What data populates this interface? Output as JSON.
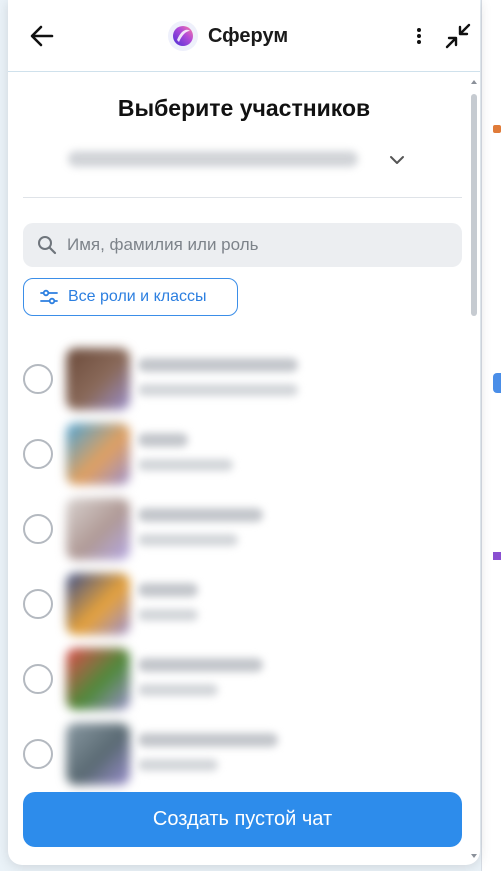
{
  "header": {
    "app_name": "Сферум",
    "icons": [
      "back-arrow-icon",
      "sferum-logo-icon",
      "more-vertical-icon",
      "minimize-icon"
    ]
  },
  "page_title": "Выберите участников",
  "search": {
    "placeholder": "Имя, фамилия или роль",
    "value": ""
  },
  "filter": {
    "label": "Все роли и классы"
  },
  "participants": [
    {
      "checked": false,
      "avatar_colors": [
        "#6b4a3a",
        "#8a6a5a",
        "#9a8fcf"
      ]
    },
    {
      "checked": false,
      "avatar_colors": [
        "#4aa3d6",
        "#e0a060",
        "#9a8fcf"
      ]
    },
    {
      "checked": false,
      "avatar_colors": [
        "#d8d2cf",
        "#b09a96",
        "#b5a8e6"
      ]
    },
    {
      "checked": false,
      "avatar_colors": [
        "#3b4f8a",
        "#e6a23b",
        "#9a8fcf"
      ]
    },
    {
      "checked": false,
      "avatar_colors": [
        "#e04b4b",
        "#4f8a3b",
        "#9a8fcf"
      ]
    },
    {
      "checked": false,
      "avatar_colors": [
        "#8a9aa3",
        "#5a6a73",
        "#9a8fcf"
      ]
    }
  ],
  "create_button": {
    "label": "Создать пустой чат"
  },
  "colors": {
    "accent": "#2d8ceb",
    "title": "#111111",
    "placeholder": "#7d838a"
  }
}
